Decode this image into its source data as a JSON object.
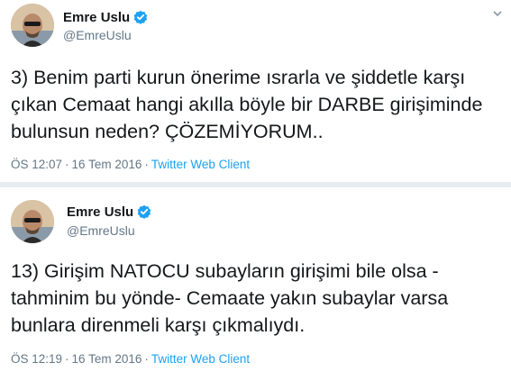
{
  "tweets": [
    {
      "author_name": "Emre Uslu",
      "author_handle": "@EmreUslu",
      "verified": true,
      "text": "3) Benim parti kurun önerime ısrarla ve şiddetle karşı çıkan Cemaat hangi akılla böyle bir DARBE girişiminde bulunsun neden? ÇÖZEMİYORUM..",
      "time": "ÖS 12:07",
      "date": "16 Tem 2016",
      "client": "Twitter Web Client"
    },
    {
      "author_name": "Emre Uslu",
      "author_handle": "@EmreUslu",
      "verified": true,
      "text": "13) Girişim NATOCU subayların girişimi bile olsa - tahminim bu yönde- Cemaate yakın subaylar varsa bunlara direnmeli karşı çıkmalıydı.",
      "time": "ÖS 12:19",
      "date": "16 Tem 2016",
      "client": "Twitter Web Client"
    }
  ],
  "separator": "·",
  "colors": {
    "link": "#1da1f2",
    "muted": "#657786",
    "text": "#14171a",
    "verified": "#1da1f2"
  },
  "icons": [
    "avatar",
    "verified-badge-icon",
    "chevron-down-icon"
  ]
}
